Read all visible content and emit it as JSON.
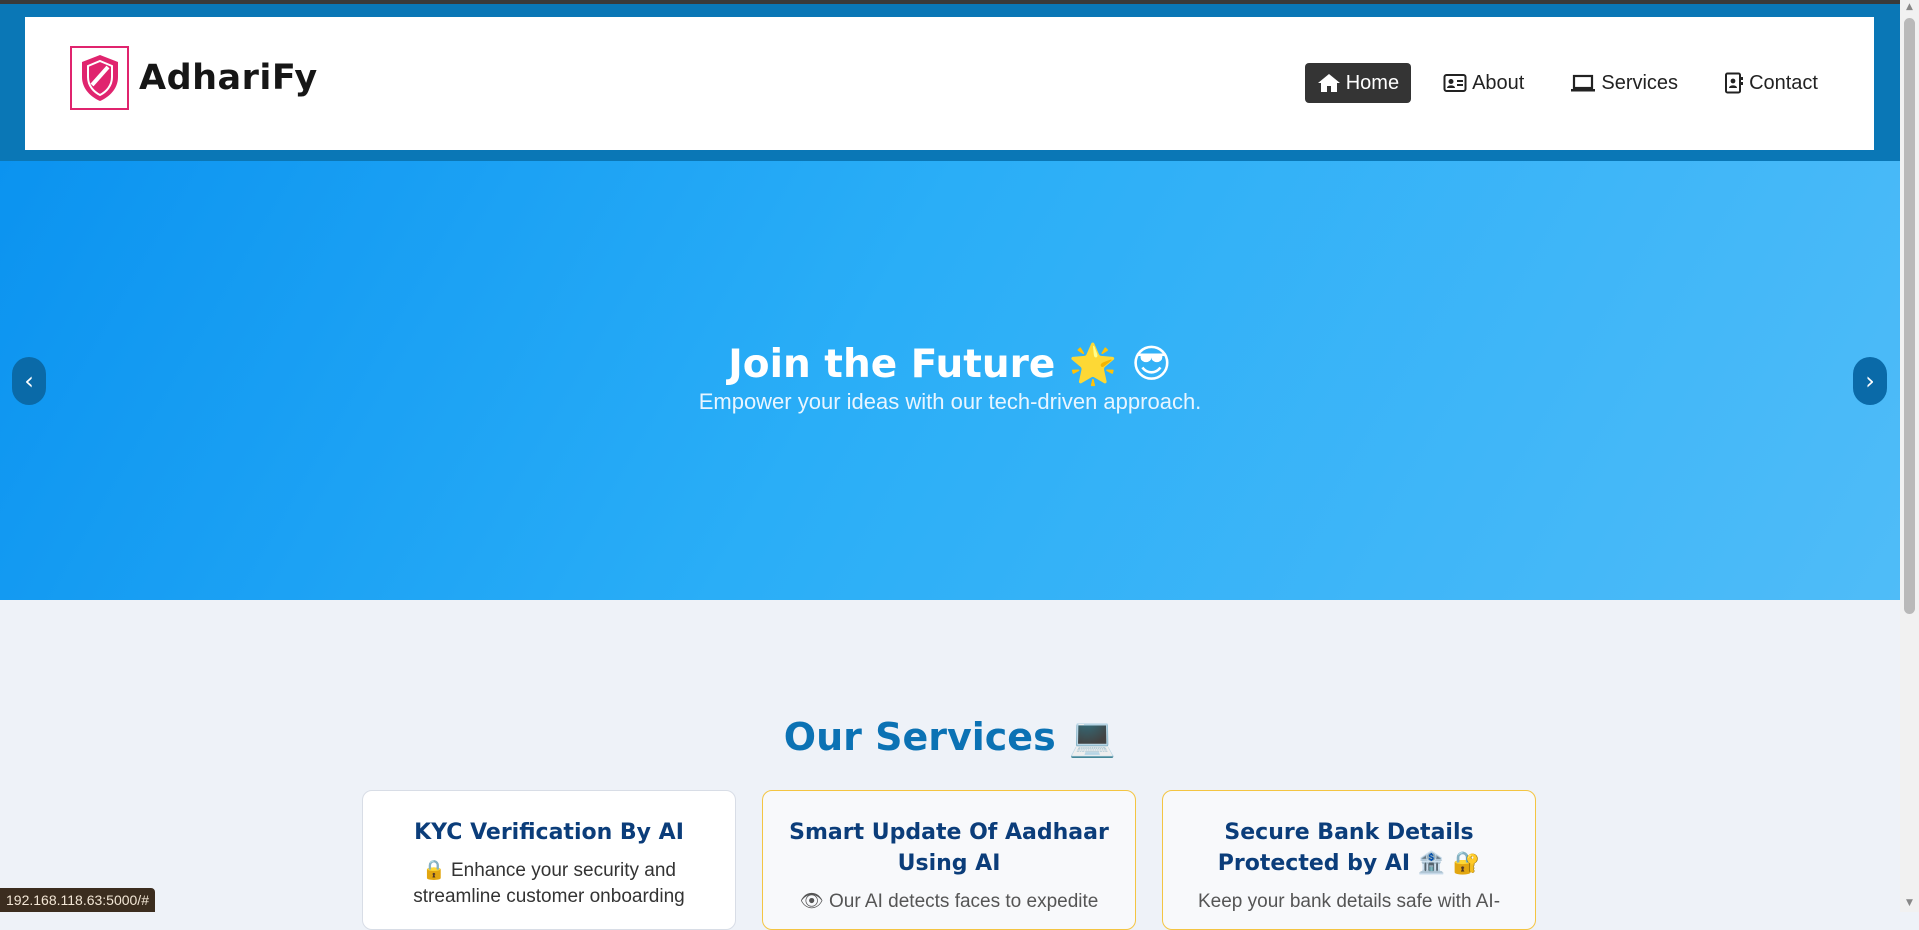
{
  "brand": {
    "name": "AdhariFy",
    "accent": "#e0246e"
  },
  "nav": {
    "items": [
      {
        "label": "Home",
        "icon": "home-icon",
        "active": true
      },
      {
        "label": "About",
        "icon": "id-card-icon",
        "active": false
      },
      {
        "label": "Services",
        "icon": "laptop-icon",
        "active": false
      },
      {
        "label": "Contact",
        "icon": "contact-book-icon",
        "active": false
      }
    ]
  },
  "hero": {
    "title": "Join the Future 🌟 😎",
    "subtitle": "Empower your ideas with our tech-driven approach.",
    "prev": "‹",
    "next": "›"
  },
  "services": {
    "title": "Our Services 💻",
    "cards": [
      {
        "title": "KYC Verification By AI",
        "text": "🔒 Enhance your security and streamline customer onboarding"
      },
      {
        "title": "Smart Update Of Aadhaar Using AI",
        "text": "👁 Our AI detects faces to expedite"
      },
      {
        "title": "Secure Bank Details Protected by AI 🏦 🔐",
        "text": "Keep your bank details safe with AI-"
      }
    ]
  },
  "status_bar": {
    "url": "192.168.118.63:5000/#"
  },
  "colors": {
    "header": "#0a77b6",
    "hero_start": "#0b93f0",
    "hero_end": "#4fbcf8",
    "active_nav": "#343434",
    "services_title": "#0b72b4"
  }
}
